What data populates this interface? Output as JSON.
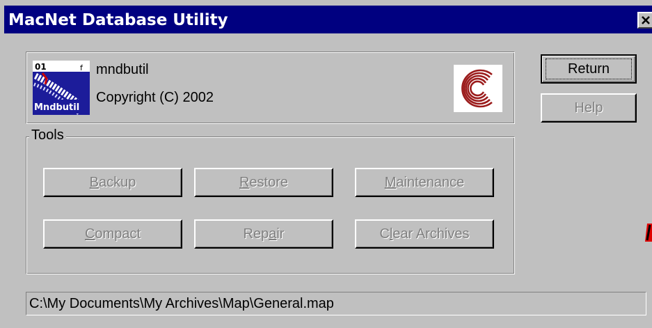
{
  "window": {
    "title": "MacNet Database Utility",
    "close_glyph": "✕",
    "colors": {
      "titlebar": "#000080",
      "face": "#c0c0c0",
      "disabled_text": "#808080"
    }
  },
  "info": {
    "icon": "mndbutil-app-icon",
    "app_name": "mndbutil",
    "copyright": "Copyright (C) 2002",
    "logo": "concentric-c-logo"
  },
  "side_buttons": {
    "return": {
      "label": "Return",
      "enabled": true,
      "default": true
    },
    "help": {
      "label": "Help",
      "enabled": false
    }
  },
  "tools": {
    "label": "Tools",
    "buttons": [
      {
        "label": "Backup",
        "access": "B",
        "rest": "ackup",
        "enabled": false
      },
      {
        "label": "Restore",
        "access": "R",
        "rest": "estore",
        "enabled": false
      },
      {
        "label": "Maintenance",
        "access": "M",
        "rest": "aintenance",
        "enabled": false
      },
      {
        "label": "Compact",
        "access": "C",
        "rest": "ompact",
        "enabled": false
      },
      {
        "label": "Repair",
        "pre": "Rep",
        "access": "a",
        "rest": "ir",
        "enabled": false
      },
      {
        "label": "Clear Archives",
        "pre": "C",
        "access": "l",
        "rest": "ear Archives",
        "enabled": false
      }
    ]
  },
  "status": {
    "path": "C:\\My Documents\\My Archives\\Map\\General.map"
  }
}
